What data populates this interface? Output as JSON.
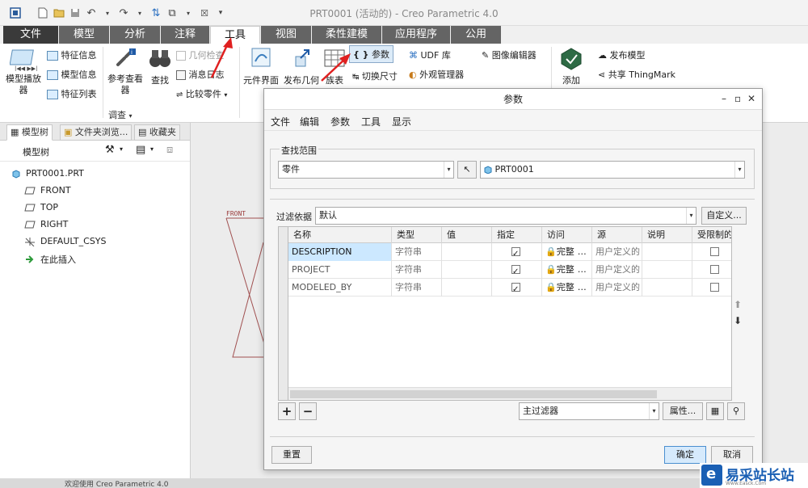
{
  "window": {
    "title": "PRT0001 (活动的) - Creo Parametric 4.0"
  },
  "ribbon_tabs": [
    {
      "label": "文件"
    },
    {
      "label": "模型"
    },
    {
      "label": "分析"
    },
    {
      "label": "注释"
    },
    {
      "label": "工具"
    },
    {
      "label": "视图"
    },
    {
      "label": "柔性建模"
    },
    {
      "label": "应用程序"
    },
    {
      "label": "公用"
    }
  ],
  "ribbon": {
    "model_player": "模型播放器",
    "feature_info": "特征信息",
    "model_info": "模型信息",
    "feature_list": "特征列表",
    "reference_viewer": "参考查看器",
    "find": "查找",
    "geometry_check": "几何检查",
    "message_log": "消息日志",
    "compare_parts": "比较零件",
    "investigate": "调查",
    "component_interface": "元件界面",
    "publish_geometry": "发布几何",
    "family_table": "族表",
    "parameters": "参数",
    "switch_dimensions": "切换尺寸",
    "udf_library": "UDF 库",
    "appearance_manager": "外观管理器",
    "image_editor": "图像编辑器",
    "add": "添加",
    "publish_model": "发布模型",
    "share_thingmark": "共享 ThingMark"
  },
  "left_panel": {
    "tabs": [
      "模型树",
      "文件夹浏览...",
      "收藏夹"
    ],
    "toolbar_label": "模型树",
    "tree": [
      {
        "label": "PRT0001.PRT",
        "icon": "part-icon"
      },
      {
        "label": "FRONT",
        "icon": "datum-plane-icon"
      },
      {
        "label": "TOP",
        "icon": "datum-plane-icon"
      },
      {
        "label": "RIGHT",
        "icon": "datum-plane-icon"
      },
      {
        "label": "DEFAULT_CSYS",
        "icon": "csys-icon"
      },
      {
        "label": "在此插入",
        "icon": "insert-arrow-icon"
      }
    ]
  },
  "graphics": {
    "front_label": "FRONT"
  },
  "dialog": {
    "title": "参数",
    "menu": [
      "文件",
      "编辑",
      "参数",
      "工具",
      "显示"
    ],
    "scope_label": "查找范围",
    "scope_type": "零件",
    "scope_object": "PRT0001",
    "filter_label": "过滤依据",
    "filter_value": "默认",
    "customize_button": "自定义...",
    "columns": [
      "名称",
      "类型",
      "值",
      "指定",
      "访问",
      "源",
      "说明",
      "受限制的"
    ],
    "rows": [
      {
        "name": "DESCRIPTION",
        "type": "字符串",
        "value": "",
        "designated": true,
        "access": "完整",
        "source": "用户定义的",
        "description": "",
        "restricted": false
      },
      {
        "name": "PROJECT",
        "type": "字符串",
        "value": "",
        "designated": true,
        "access": "完整",
        "source": "用户定义的",
        "description": "",
        "restricted": false
      },
      {
        "name": "MODELED_BY",
        "type": "字符串",
        "value": "",
        "designated": true,
        "access": "完整",
        "source": "用户定义的",
        "description": "",
        "restricted": false
      }
    ],
    "main_filter": "主过滤器",
    "properties_button": "属性...",
    "reset_button": "重置",
    "ok_button": "确定",
    "cancel_button": "取消"
  },
  "status": {
    "text": "欢迎使用 Creo Parametric 4.0"
  },
  "watermark": {
    "text": "易采站长站",
    "sub": "Www.Easck.Com"
  },
  "colors": {
    "tab_dark": "#646464",
    "file_tab": "#3a3a3a",
    "selection": "#cce8ff",
    "arrow_red": "#e02020",
    "watermark_blue": "#1a5fb4"
  }
}
